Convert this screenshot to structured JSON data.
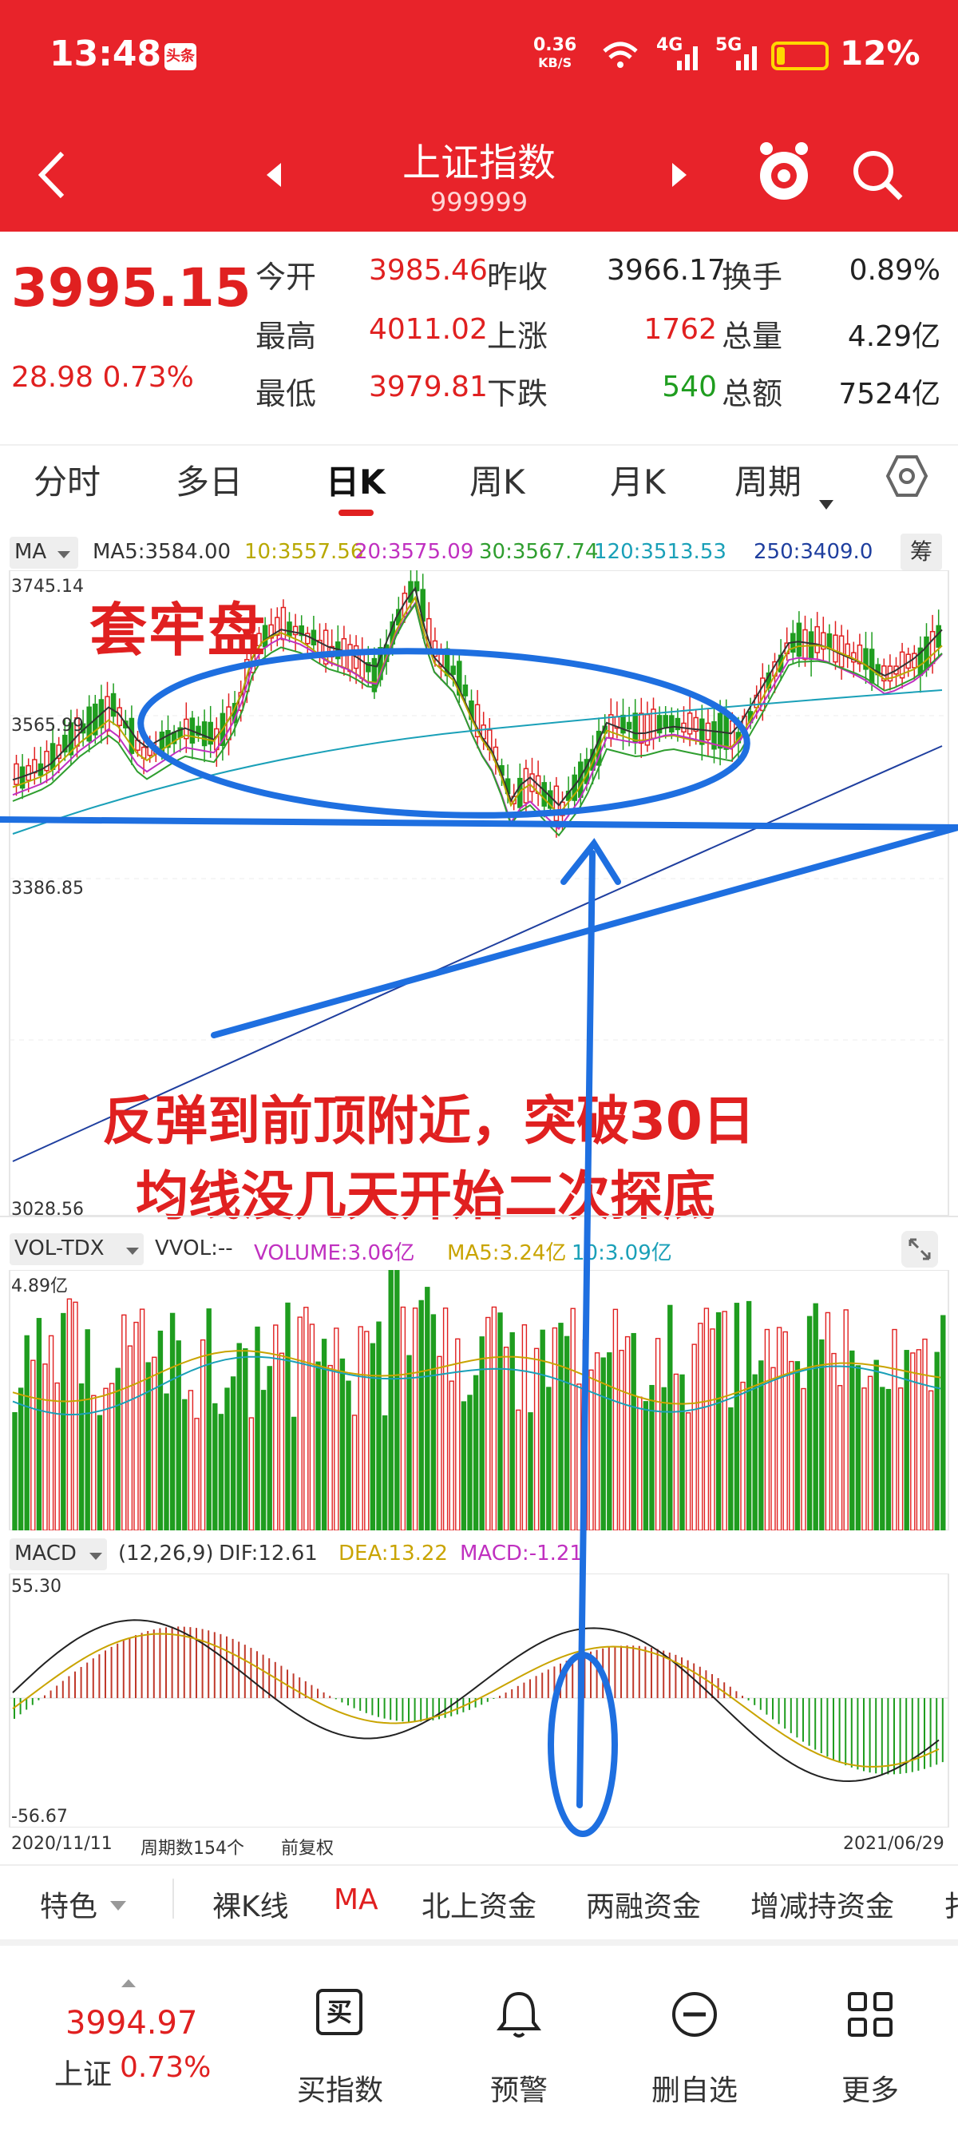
{
  "status_bar": {
    "time": "13:48",
    "app_badge": "头条",
    "net_speed_value": "0.36",
    "net_speed_unit": "KB/S",
    "network": "4G 5G",
    "battery": "12%"
  },
  "nav": {
    "title": "上证指数",
    "code": "999999",
    "icons": [
      "back-icon",
      "prev-icon",
      "next-icon",
      "mascot-icon",
      "search-icon"
    ]
  },
  "quote": {
    "price": "3995.15",
    "change": "28.98  0.73%",
    "rows": [
      [
        {
          "label": "今开",
          "value": "3985.46",
          "color": "red"
        },
        {
          "label": "昨收",
          "value": "3966.17",
          "color": "blk"
        },
        {
          "label": "换手",
          "value": "0.89%",
          "color": "blk"
        }
      ],
      [
        {
          "label": "最高",
          "value": "4011.02",
          "color": "red"
        },
        {
          "label": "上涨",
          "value": "1762",
          "color": "red"
        },
        {
          "label": "总量",
          "value": "4.29亿",
          "color": "blk"
        }
      ],
      [
        {
          "label": "最低",
          "value": "3979.81",
          "color": "red"
        },
        {
          "label": "下跌",
          "value": "540",
          "color": "green"
        },
        {
          "label": "总额",
          "value": "7524亿",
          "color": "blk"
        }
      ]
    ]
  },
  "tabs": [
    "分时",
    "多日",
    "日K",
    "周K",
    "月K",
    "周期"
  ],
  "active_tab": 2,
  "kline": {
    "indicator": "MA",
    "ma_values": [
      {
        "text": "MA5:3584.00",
        "color": "#333333"
      },
      {
        "text": "10:3557.56",
        "color": "#b8a800"
      },
      {
        "text": "20:3575.09",
        "color": "#c030c0"
      },
      {
        "text": "30:3567.74",
        "color": "#2f9e2f"
      },
      {
        "text": "120:3513.53",
        "color": "#1aa0b8"
      },
      {
        "text": "250:3409.0",
        "color": "#1f3f9f"
      }
    ],
    "more": "筹",
    "y_ticks": [
      "3745.14",
      "3565.99",
      "3386.85",
      "3028.56"
    ]
  },
  "annotations": {
    "title": "套牢盘",
    "line1": "反弹到前顶附近，突破30日",
    "line2": "均线没几天开始二次探底"
  },
  "volume": {
    "indicator": "VOL-TDX",
    "vvol": "VVOL:--",
    "volume": "VOLUME:3.06亿",
    "ma5": "MA5:3.24亿",
    "ma10": "10:3.09亿",
    "y_top": "4.89亿"
  },
  "macd": {
    "indicator": "MACD",
    "params": "(12,26,9)",
    "dif": "DIF:12.61",
    "dea": "DEA:13.22",
    "macd": "MACD:-1.21",
    "y_top": "55.30",
    "y_bottom": "-56.67"
  },
  "footer_axis": {
    "start_date": "2020/11/11",
    "periods": "周期数154个",
    "adjust": "前复权",
    "end_date": "2021/06/29"
  },
  "indicator_tabs": [
    "特色",
    "裸K线",
    "MA",
    "北上资金",
    "两融资金",
    "增减持资金",
    "扌"
  ],
  "active_indicator": 2,
  "bottom_bar": {
    "price": "3994.97",
    "name": "上证",
    "change": "0.73%",
    "actions": [
      {
        "label": "买指数",
        "icon": "buy-icon",
        "glyph": "买"
      },
      {
        "label": "预警",
        "icon": "bell-icon"
      },
      {
        "label": "删自选",
        "icon": "remove-icon"
      },
      {
        "label": "更多",
        "icon": "grid-icon"
      }
    ]
  },
  "colors": {
    "brand": "#e8232a",
    "up": "#e02020",
    "down": "#1f9d1f",
    "annotation": "#1e6fe0"
  }
}
